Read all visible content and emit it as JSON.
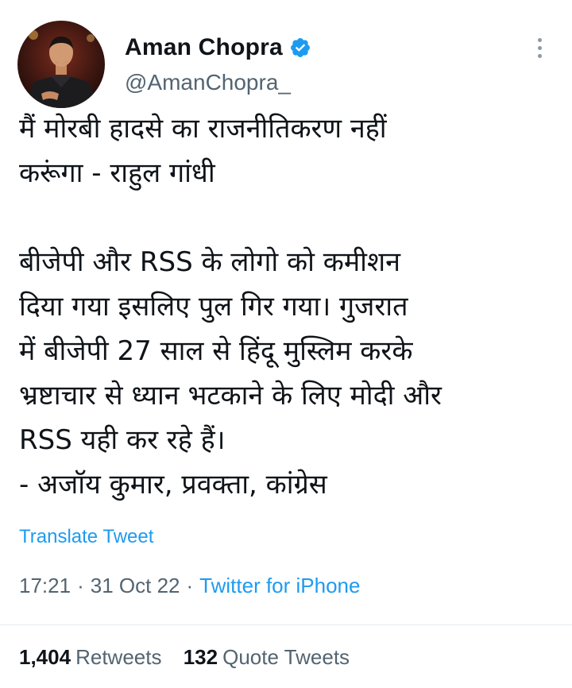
{
  "author": {
    "name": "Aman Chopra",
    "handle": "@AmanChopra_",
    "verified": true
  },
  "tweet": {
    "lines": [
      "मैं मोरबी हादसे का राजनीतिकरण नहीं",
      "करूंगा - राहुल गांधी",
      "",
      "बीजेपी और RSS के लोगो को कमीशन",
      "दिया गया इसलिए पुल गिर गया। गुजरात",
      "में बीजेपी 27 साल से हिंदू मुस्लिम करके",
      "भ्रष्टाचार से ध्यान भटकाने के लिए मोदी और",
      "RSS यही कर रहे हैं।",
      "- अजॉय कुमार, प्रवक्ता, कांग्रेस"
    ],
    "translate_label": "Translate Tweet"
  },
  "meta": {
    "time": "17:21",
    "separator": "·",
    "date": "31 Oct 22",
    "source": "Twitter for iPhone"
  },
  "stats": {
    "retweets_count": "1,404",
    "retweets_label": "Retweets",
    "quotes_count": "132",
    "quotes_label": "Quote Tweets"
  },
  "colors": {
    "link": "#1d9bf0",
    "secondary_text": "#536471",
    "primary_text": "#0f1419"
  }
}
